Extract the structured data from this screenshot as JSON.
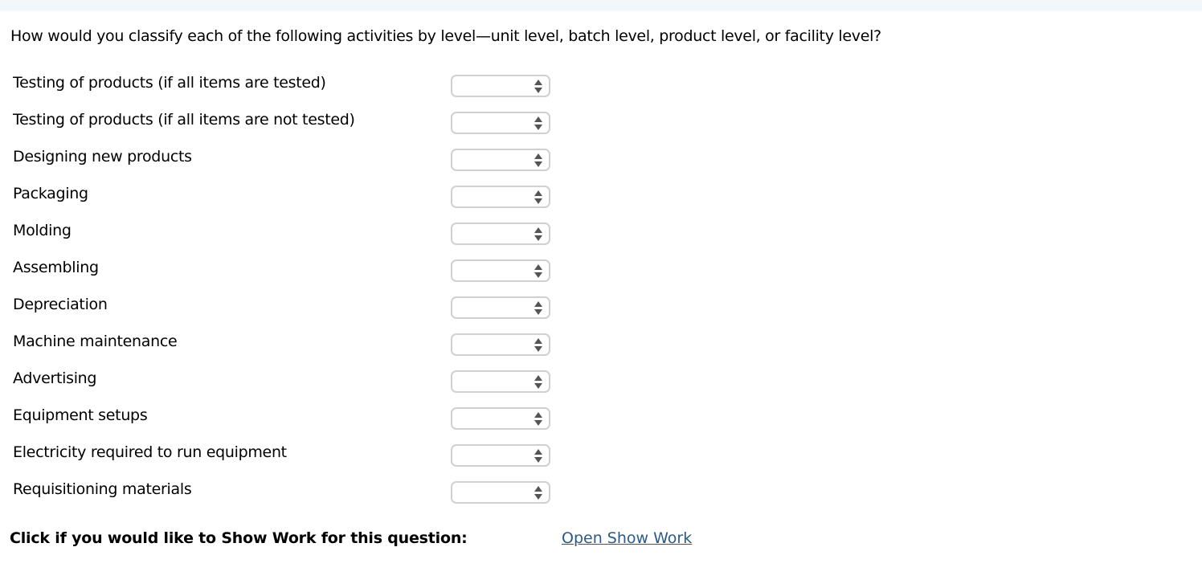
{
  "question": "How would you classify each of the following activities by level—unit level, batch level, product level, or facility level?",
  "activities": [
    {
      "label": "Testing of products (if all items are tested)",
      "selected": ""
    },
    {
      "label": "Testing of products (if all items are not tested)",
      "selected": ""
    },
    {
      "label": "Designing new products",
      "selected": ""
    },
    {
      "label": "Packaging",
      "selected": ""
    },
    {
      "label": "Molding",
      "selected": ""
    },
    {
      "label": "Assembling",
      "selected": ""
    },
    {
      "label": "Depreciation",
      "selected": ""
    },
    {
      "label": "Machine maintenance",
      "selected": ""
    },
    {
      "label": "Advertising",
      "selected": ""
    },
    {
      "label": "Equipment setups",
      "selected": ""
    },
    {
      "label": "Electricity required to run equipment",
      "selected": ""
    },
    {
      "label": "Requisitioning materials",
      "selected": ""
    }
  ],
  "footer": {
    "label": "Click if you would like to Show Work for this question:",
    "link_label": "Open Show Work"
  },
  "icons": {
    "select_arrow": "up-down-chevron-icon"
  },
  "colors": {
    "link": "#2a5a8a",
    "select_border": "#d0d0d0",
    "top_bar": "#f4f7fa"
  }
}
